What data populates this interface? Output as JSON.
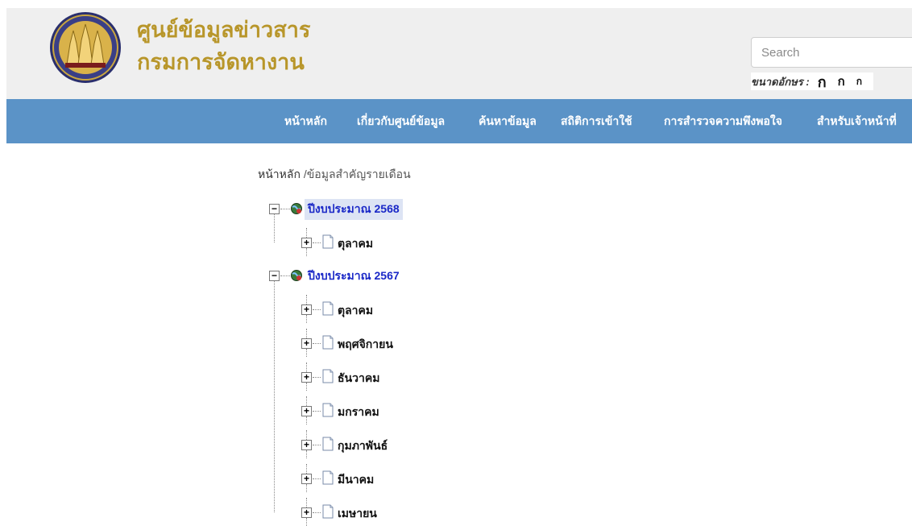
{
  "header": {
    "title_line1": "ศูนย์ข้อมูลข่าวสาร",
    "title_line2": "กรมการจัดหางาน",
    "search_placeholder": "Search",
    "font_size_label": "ขนาดอักษร :",
    "font_size_options": [
      "ก",
      "ก",
      "ก"
    ]
  },
  "nav": {
    "items": [
      "หน้าหลัก",
      "เกี่ยวกับศูนย์ข้อมูล",
      "ค้นหาข้อมูล",
      "สถิติการเข้าใช้",
      "การสำรวจความพึงพอใจ",
      "สำหรับเจ้าหน้าที่"
    ]
  },
  "breadcrumb": {
    "home": "หน้าหลัก",
    "current": " /ข้อมูลสำคัญรายเดือน"
  },
  "tree": {
    "years": [
      {
        "label": "ปีงบประมาณ 2568",
        "selected": true,
        "months": [
          "ตุลาคม"
        ]
      },
      {
        "label": "ปีงบประมาณ 2567",
        "selected": false,
        "months": [
          "ตุลาคม",
          "พฤศจิกายน",
          "ธันวาคม",
          "มกราคม",
          "กุมภาพันธ์",
          "มีนาคม",
          "เมษายน"
        ]
      }
    ]
  },
  "colors": {
    "nav_bg": "#5b93c7",
    "title_gold": "#b8962a",
    "year_link": "#1a28c7",
    "header_bg": "#efefef"
  }
}
